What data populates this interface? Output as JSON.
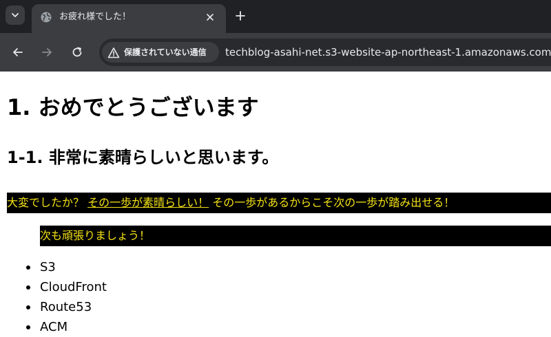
{
  "browser": {
    "tab": {
      "title": "お疲れ様でした！"
    },
    "omnibox": {
      "security_label": "保護されていない通信",
      "url": "techblog-asahi-net.s3-website-ap-northeast-1.amazonaws.com"
    },
    "colors": {
      "tabstrip": "#202124",
      "toolbar": "#3c3d40",
      "text": "#e8eaed"
    }
  },
  "page": {
    "h1": "1. おめでとうございます",
    "h2": "1-1. 非常に素晴らしいと思います。",
    "banner1": {
      "text_before": "大変でしたか？",
      "link_text": "その一歩が素晴らしい！",
      "text_after": "その一歩があるからこそ次の一歩が踏み出せる！"
    },
    "banner2": "次も頑張りましょう！",
    "list": [
      {
        "label": "S3"
      },
      {
        "label": "CloudFront"
      },
      {
        "label": "Route53"
      },
      {
        "label": "ACM"
      }
    ],
    "colors": {
      "banner_bg": "#000000",
      "banner_text": "#f5e313"
    }
  }
}
